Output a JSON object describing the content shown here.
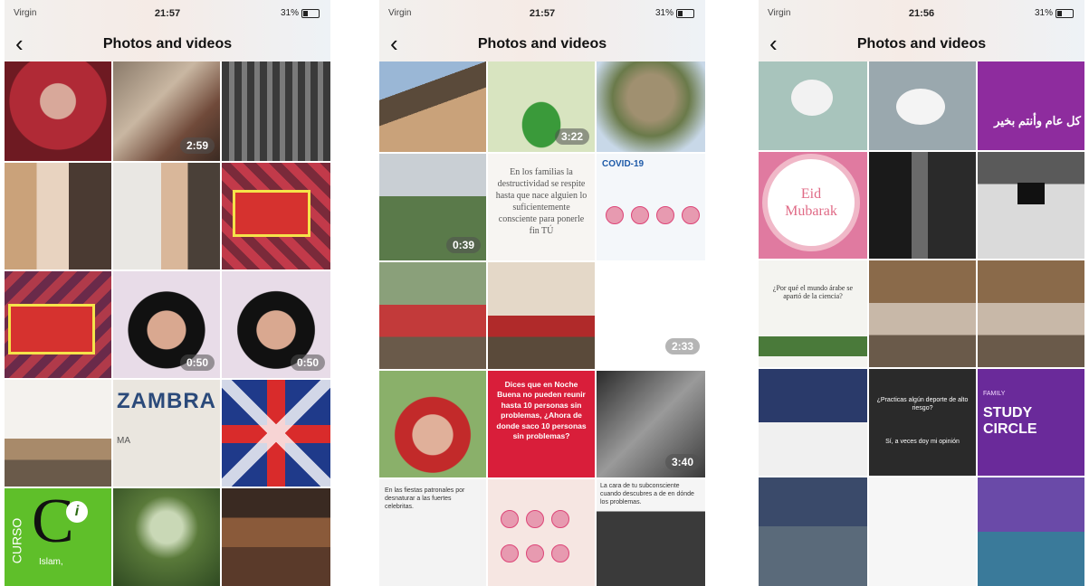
{
  "screens": [
    {
      "status": {
        "carrier": "Virgin",
        "time": "21:57",
        "battery": "31%"
      },
      "title": "Photos and videos",
      "durations": [
        "2:59",
        "0:50",
        "0:50"
      ],
      "zambra": {
        "title": "ZAMBRA",
        "sub": "MA"
      },
      "curso": {
        "vertical": "CURSO",
        "label": "Islam,"
      }
    },
    {
      "status": {
        "carrier": "Virgin",
        "time": "21:57",
        "battery": "31%"
      },
      "title": "Photos and videos",
      "durations": [
        "3:22",
        "0:39",
        "2:33",
        "3:40"
      ],
      "quote": "En los familias la destructividad se respite hasta que nace alguien lo suficientemente consciente para ponerle fin TÚ",
      "covid": "COVID-19",
      "red_text": "Dices que en Noche Buena no pueden reunir hasta 10 personas sin problemas, ¿Ahora de donde saco 10 personas sin problemas?",
      "small_text_1": "En las fiestas patronales por desnaturar a las fuertes celebritas.",
      "small_text_2": "La cara de tu subconsciente cuando descubres a de en dónde los problemas."
    },
    {
      "status": {
        "carrier": "Virgin",
        "time": "21:56",
        "battery": "31%"
      },
      "title": "Photos and videos",
      "eid": [
        "Eid",
        "Mubarak"
      ],
      "arabic": "كل عام وأنتم بخير",
      "study": {
        "top": "FAMILY",
        "main": "STUDY CIRCLE"
      },
      "dark_text": "¿Practicas algún deporte de alto riesgo?",
      "dark_answer": "Sí, a veces doy mi opinión",
      "science_text": "¿Por qué el mundo árabe se apartó de la ciencia?"
    }
  ]
}
